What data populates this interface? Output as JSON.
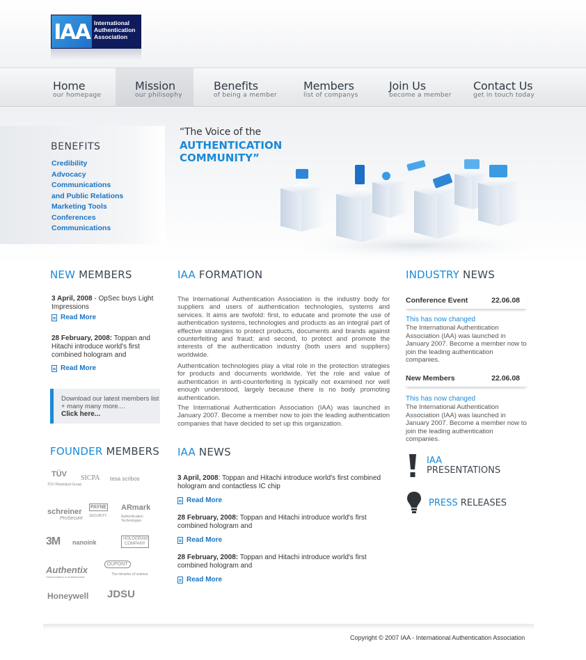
{
  "logo": {
    "mark": "IAA",
    "text": "International Authentication Association"
  },
  "nav": [
    {
      "title": "Home",
      "sub": "our homepage"
    },
    {
      "title": "Mission",
      "sub": "our philisophy"
    },
    {
      "title": "Benefits",
      "sub": "of being a member"
    },
    {
      "title": "Members",
      "sub": "list of companys"
    },
    {
      "title": "Join Us",
      "sub": "become a member"
    },
    {
      "title": "Contact Us",
      "sub": "get in touch today"
    }
  ],
  "benefits": {
    "title": "BENEFITS",
    "items": [
      "Credibility",
      "Advocacy",
      "Communications",
      "and Public Relations",
      "Marketing Tools",
      "Conferences",
      "Communications"
    ]
  },
  "hero": {
    "line1": "“The Voice of the",
    "line2": "AUTHENTICATION COMMUNITY”"
  },
  "new_members": {
    "title_hl": "NEW",
    "title_rest": " MEMBERS",
    "items": [
      {
        "date": "3 April, 2008",
        "text": " - OpSec buys Light Impressions",
        "more": "Read More"
      },
      {
        "date": "28 February, 2008:",
        "text": " Toppan and Hitachi introduce world's first combined hologram and",
        "more": "Read More"
      }
    ],
    "download": {
      "text": "Download our latest  members list + many many more....",
      "link": "Click here..."
    }
  },
  "founder": {
    "title_hl": "FOUNDER",
    "title_rest": " MEMBERS",
    "logos": [
      "TÜV",
      "TÜV Rheinland Group",
      "SICPA",
      "tesa scribos",
      "schreiner",
      "ProSecure",
      "PAYNE",
      "SECURITY",
      "ARmark",
      "Authentication Technologies",
      "3M",
      "nanoink",
      "HOLOGRAM COMPANY",
      "Authentix",
      "Global leaders in authentication",
      "DUPONT",
      "The miracles of science",
      "Honeywell",
      "JDSU"
    ]
  },
  "formation": {
    "title_hl": "IAA",
    "title_rest": " FORMATION",
    "p1": "The International Authentication Association  is the industry body for suppliers and users of authentication technologies, systems and services. It aims are twofold: first, to educate and promote the use of authentication systems, technologies and products as an integral part of effective strategies to protect products, documents and brands against counterfeiting and fraud; and second, to protect and promote the interests of the authentication industry (both users and suppliers) worldwide.",
    "p2": "Authentication technologies play a vital role in the protection strategies for products and documents worldwide. Yet the role and value of authentication in anti-counterfeiting is typically not examined nor well enough understood, largely because there is no body promoting authentication.",
    "p3": "The International Authentication Association (IAA) was launched in January 2007. Become a member now to join the leading authentication companies that have decided to set up this organization."
  },
  "iaa_news": {
    "title_hl": "IAA",
    "title_rest": " NEWS",
    "items": [
      {
        "date": "3 April, 2008",
        "text": ": Toppan and Hitachi introduce world's first combined hologram and contactless IC chip",
        "more": "Read More"
      },
      {
        "date": "28 February, 2008:",
        "text": " Toppan and Hitachi introduce world's first combined hologram and",
        "more": "Read More"
      },
      {
        "date": "28 February, 2008:",
        "text": " Toppan and Hitachi introduce world's first combined hologram and",
        "more": "Read More"
      }
    ]
  },
  "industry": {
    "title_hl": "INDUSTRY",
    "title_rest": " NEWS",
    "items": [
      {
        "event": "Conference Event",
        "date": "22.06.08",
        "changed": "This has now changed",
        "text": "The International Authentication Association (IAA) was launched in January 2007. Become a member now to join the leading authentication companies."
      },
      {
        "event": "New Members",
        "date": "22.06.08",
        "changed": "This has now changed",
        "text": "The International Authentication Association (IAA) was launched in January 2007. Become a member now to join the leading authentication companies."
      }
    ]
  },
  "presentations": {
    "hl": "IAA",
    "rest": "PRESENTATIONS"
  },
  "press": {
    "hl": "PRESS",
    "rest": " RELEASES"
  },
  "footer": {
    "copyright": "Copyright © 2007 IAA - International Authentication Association"
  },
  "colors": {
    "accent": "#1a8ad8",
    "link": "#1a74c2",
    "logo_bg": "#0e1b5c"
  },
  "icons": [
    "exclamation-icon",
    "lightbulb-icon",
    "doc-icon"
  ]
}
